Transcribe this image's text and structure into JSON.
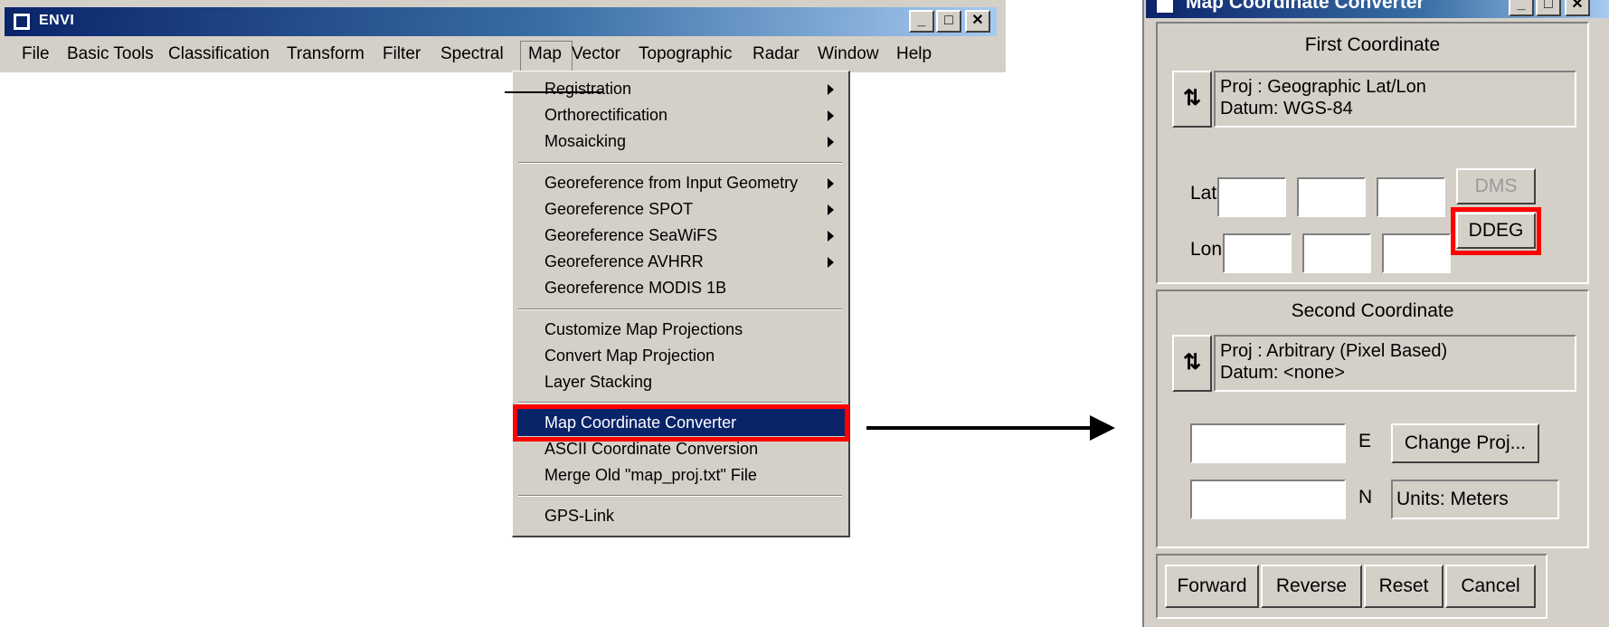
{
  "envi": {
    "title": "ENVI",
    "window_buttons": [
      "_",
      "□",
      "✕"
    ],
    "menu": [
      "File",
      "Basic Tools",
      "Classification",
      "Transform",
      "Filter",
      "Spectral",
      "Map",
      "Vector",
      "Topographic",
      "Radar",
      "Window",
      "Help"
    ],
    "open_menu": "Map"
  },
  "map_menu": {
    "items": [
      {
        "label": "Registration",
        "submenu": true
      },
      {
        "label": "Orthorectification",
        "submenu": true
      },
      {
        "label": "Mosaicking",
        "submenu": true
      },
      {
        "label": "Georeference from Input Geometry",
        "submenu": true
      },
      {
        "label": "Georeference SPOT",
        "submenu": true
      },
      {
        "label": "Georeference SeaWiFS",
        "submenu": true
      },
      {
        "label": "Georeference AVHRR",
        "submenu": true
      },
      {
        "label": "Georeference MODIS 1B",
        "submenu": false
      },
      {
        "label": "Customize Map Projections",
        "submenu": false
      },
      {
        "label": "Convert Map Projection",
        "submenu": false
      },
      {
        "label": "Layer Stacking",
        "submenu": false
      },
      {
        "label": "Map Coordinate Converter",
        "submenu": false,
        "highlighted": true
      },
      {
        "label": "ASCII Coordinate Conversion",
        "submenu": false
      },
      {
        "label": "Merge Old \"map_proj.txt\" File",
        "submenu": false
      },
      {
        "label": "GPS-Link",
        "submenu": false
      }
    ]
  },
  "dialog": {
    "title": "Map Coordinate Converter",
    "window_buttons": [
      "_",
      "□",
      "✕"
    ],
    "first": {
      "heading": "First Coordinate",
      "proj": "Proj : Geographic Lat/Lon",
      "datum": "Datum: WGS-84",
      "lat_label": "Lat",
      "lon_label": "Lon",
      "dms_label": "DMS",
      "ddeg_label": "DDEG"
    },
    "second": {
      "heading": "Second Coordinate",
      "proj": "Proj : Arbitrary (Pixel Based)",
      "datum": "Datum: <none>",
      "e_label": "E",
      "n_label": "N",
      "change_proj_label": "Change Proj...",
      "units": "Units: Meters"
    },
    "buttons": [
      "Forward",
      "Reverse",
      "Reset",
      "Cancel"
    ]
  },
  "colors": {
    "highlight": "#0a246a",
    "callout": "#ff0000",
    "face": "#d4d0c8"
  }
}
